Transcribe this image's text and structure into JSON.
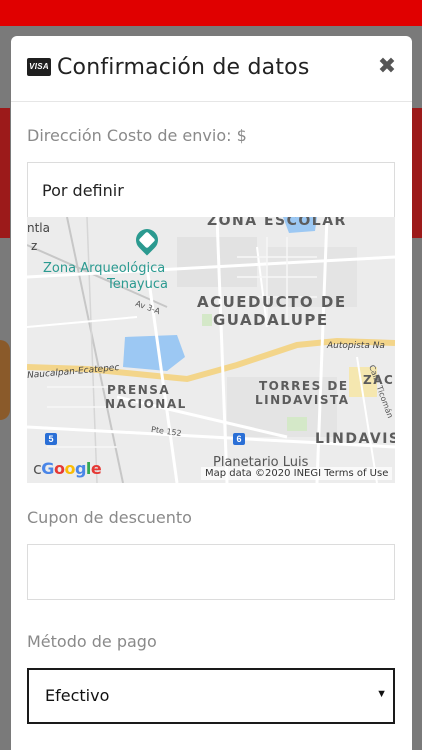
{
  "modal": {
    "title": "Confirmación de datos",
    "card_icon_text": "VISA",
    "close_glyph": "✖"
  },
  "address": {
    "label": "Dirección Costo de envio: $",
    "value": "Por definir"
  },
  "map": {
    "labels": {
      "zona_escolar": "ZONA ESCOLAR",
      "zona_arqueologica": "Zona Arqueológica",
      "tenayuca": "Tenayuca",
      "acueducto": "ACUEDUCTO DE",
      "guadalupe": "GUADALUPE",
      "autopista": "Autopista Na",
      "naucalpan": "Naucalpan-Ecatepec",
      "prensa": "PRENSA",
      "nacional": "NACIONAL",
      "torres": "TORRES DE",
      "lindavista": "LINDAVISTA",
      "lindavis": "LINDAVIS",
      "planetario": "Planetario Luis",
      "pte152": "Pte 152",
      "av3a": "Av 3-A",
      "calz_ticoman": "Calz. Ticomán",
      "tlan": "ntla",
      "z": "z",
      "zac": "ZAC",
      "shield5": "5",
      "shield6": "6",
      "c_prefix": "c",
      "google": "Google"
    },
    "attribution": "Map data ©2020 INEGI   Terms of Use",
    "colors": {
      "land": "#ececec",
      "road_major": "#f3d58a",
      "water": "#9cc8f3",
      "poi_teal": "#2b9a90",
      "shield_blue": "#2a6fd6"
    }
  },
  "coupon": {
    "label": "Cupon de descuento",
    "value": ""
  },
  "payment": {
    "label": "Método de pago",
    "selected": "Efectivo"
  },
  "colors": {
    "brand_red": "#e00000",
    "overlay": "#7a7a7a"
  }
}
